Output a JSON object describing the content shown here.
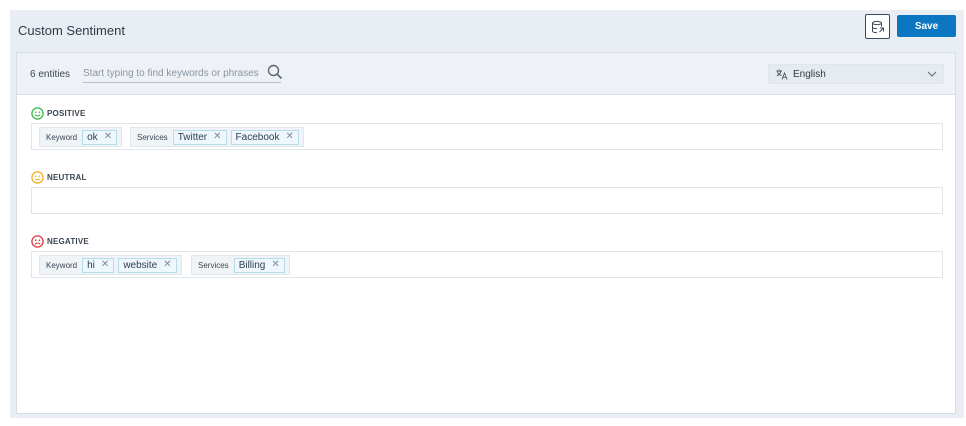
{
  "header": {
    "title": "Custom Sentiment",
    "save_label": "Save",
    "export_icon": "database-export-icon"
  },
  "toolbar": {
    "entity_count": "6 entities",
    "search_placeholder": "Start typing to find keywords or phrases",
    "language": "English"
  },
  "sections": {
    "positive": {
      "label": "POSITIVE",
      "color": "#3bb54a",
      "groups": [
        {
          "label": "Keyword",
          "chips": [
            "ok"
          ]
        },
        {
          "label": "Services",
          "chips": [
            "Twitter",
            "Facebook"
          ]
        }
      ]
    },
    "neutral": {
      "label": "NEUTRAL",
      "color": "#f2b01e",
      "groups": []
    },
    "negative": {
      "label": "NEGATIVE",
      "color": "#e0383e",
      "groups": [
        {
          "label": "Keyword",
          "chips": [
            "hi",
            "website"
          ]
        },
        {
          "label": "Services",
          "chips": [
            "Billing"
          ]
        }
      ]
    }
  },
  "colors": {
    "accent": "#0b76c1",
    "chip_bg": "#eef7fb",
    "chip_border": "#b8dbe8"
  }
}
